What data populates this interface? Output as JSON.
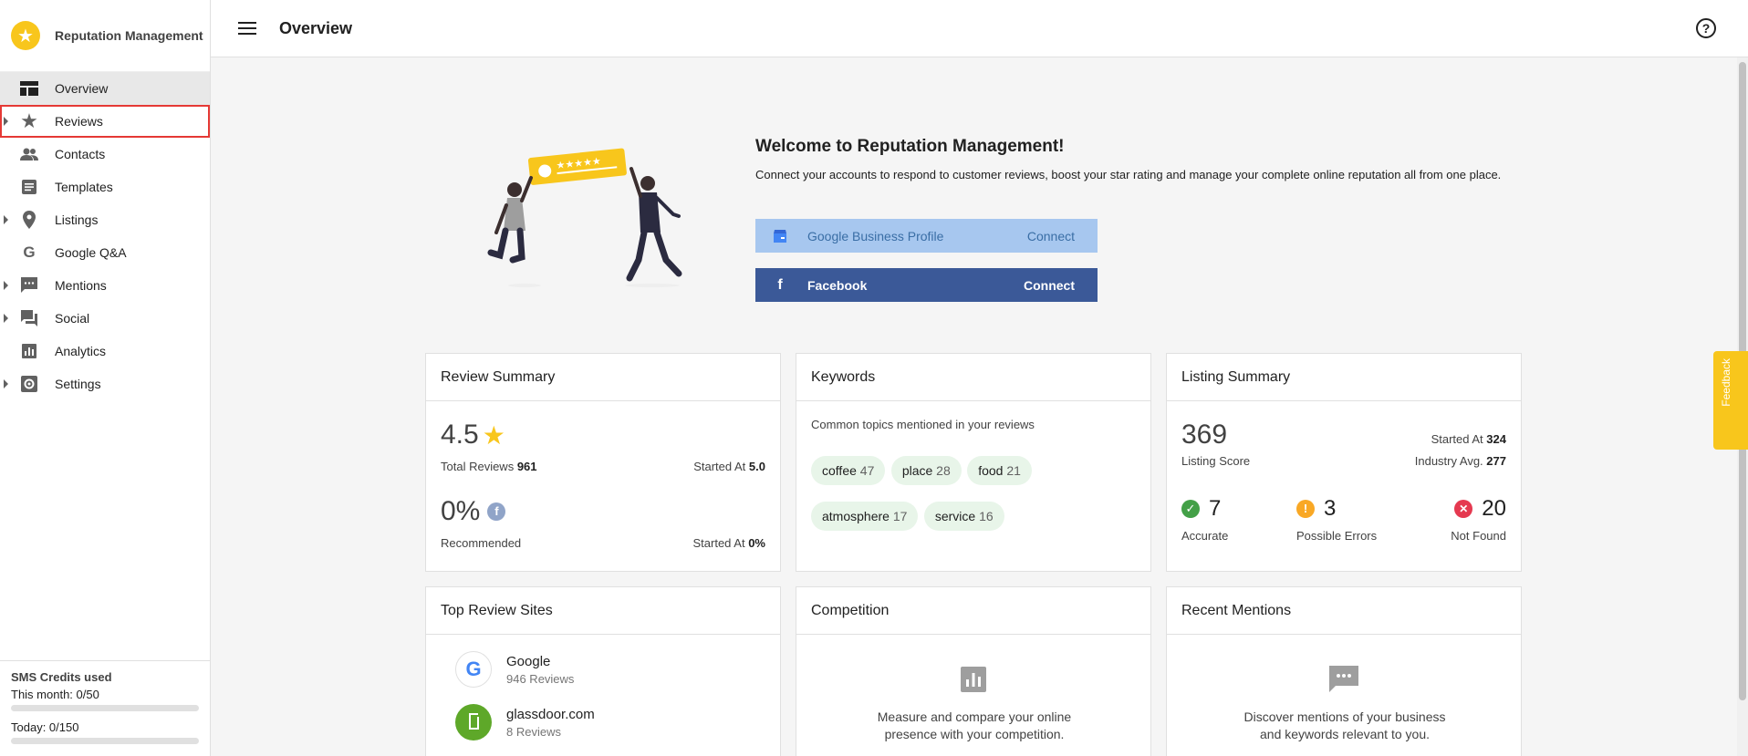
{
  "app": {
    "name": "Reputation Management"
  },
  "header": {
    "title": "Overview",
    "help_icon": "help-circle-icon"
  },
  "sidebar": {
    "items": [
      {
        "label": "Overview",
        "icon": "dashboard-icon",
        "has_caret": false,
        "active": true
      },
      {
        "label": "Reviews",
        "icon": "star-icon",
        "has_caret": true
      },
      {
        "label": "Contacts",
        "icon": "people-icon",
        "has_caret": false
      },
      {
        "label": "Templates",
        "icon": "document-icon",
        "has_caret": false
      },
      {
        "label": "Listings",
        "icon": "location-pin-icon",
        "has_caret": true
      },
      {
        "label": "Google Q&A",
        "icon": "google-icon",
        "has_caret": false
      },
      {
        "label": "Mentions",
        "icon": "chat-bubble-icon",
        "has_caret": true
      },
      {
        "label": "Social",
        "icon": "forum-icon",
        "has_caret": true
      },
      {
        "label": "Analytics",
        "icon": "bar-chart-icon",
        "has_caret": false
      },
      {
        "label": "Settings",
        "icon": "settings-icon",
        "has_caret": true
      }
    ]
  },
  "sms": {
    "title": "SMS Credits used",
    "month": "This month: 0/50",
    "today": "Today: 0/150",
    "month_progress": 0,
    "today_progress": 0
  },
  "welcome": {
    "title": "Welcome to Reputation Management!",
    "text": "Connect your accounts to respond to customer reviews, boost your star rating and manage your complete online reputation all from one place.",
    "gbp_label": "Google Business Profile",
    "gbp_action": "Connect",
    "fb_label": "Facebook",
    "fb_action": "Connect"
  },
  "review_summary": {
    "title": "Review Summary",
    "rating": "4.5",
    "total_label": "Total Reviews",
    "total_value": "961",
    "started_label": "Started At",
    "started_value": "5.0",
    "recommended": "0%",
    "recommended_label": "Recommended",
    "started2_value": "0%"
  },
  "keywords": {
    "title": "Keywords",
    "subtitle": "Common topics mentioned in your reviews",
    "chips": [
      {
        "word": "coffee",
        "count": "47"
      },
      {
        "word": "place",
        "count": "28"
      },
      {
        "word": "food",
        "count": "21"
      },
      {
        "word": "atmosphere",
        "count": "17"
      },
      {
        "word": "service",
        "count": "16"
      }
    ]
  },
  "listing_summary": {
    "title": "Listing Summary",
    "score": "369",
    "score_label": "Listing Score",
    "started_label": "Started At",
    "started_value": "324",
    "industry_label": "Industry Avg.",
    "industry_value": "277",
    "accurate": "7",
    "accurate_label": "Accurate",
    "errors": "3",
    "errors_label": "Possible Errors",
    "not_found": "20",
    "not_found_label": "Not Found",
    "colors": {
      "accurate": "#43a047",
      "errors": "#f9a825",
      "not_found": "#e53950"
    }
  },
  "top_sites": {
    "title": "Top Review Sites",
    "sites": [
      {
        "name": "Google",
        "reviews": "946 Reviews"
      },
      {
        "name": "glassdoor.com",
        "reviews": "8 Reviews"
      }
    ]
  },
  "competition": {
    "title": "Competition",
    "text1": "Measure and compare your online",
    "text2": "presence with your competition."
  },
  "mentions": {
    "title": "Recent Mentions",
    "text1": "Discover mentions of your business",
    "text2": "and keywords relevant to you."
  },
  "feedback": {
    "label": "Feedback"
  },
  "colors": {
    "accent": "#f8c61c",
    "facebook": "#3b5998",
    "gbp": "#a7c7ef"
  }
}
